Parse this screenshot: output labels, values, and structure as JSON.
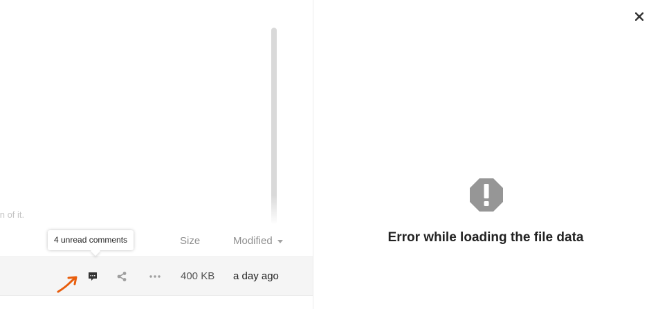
{
  "file_list": {
    "faded_text": "tion of it.",
    "columns": {
      "size": "Size",
      "modified": "Modified"
    },
    "row": {
      "size": "400 KB",
      "modified": "a day ago"
    },
    "tooltip": "4 unread comments"
  },
  "sidebar": {
    "error_message": "Error while loading the file data"
  },
  "colors": {
    "accent_annotation": "#e85d0c",
    "row_background": "#f5f5f5",
    "error_icon": "#969696"
  },
  "icons": {
    "comments": "comment-icon",
    "share": "share-icon",
    "more": "more-icon",
    "close": "close-icon",
    "error": "warning-octagon-icon"
  }
}
